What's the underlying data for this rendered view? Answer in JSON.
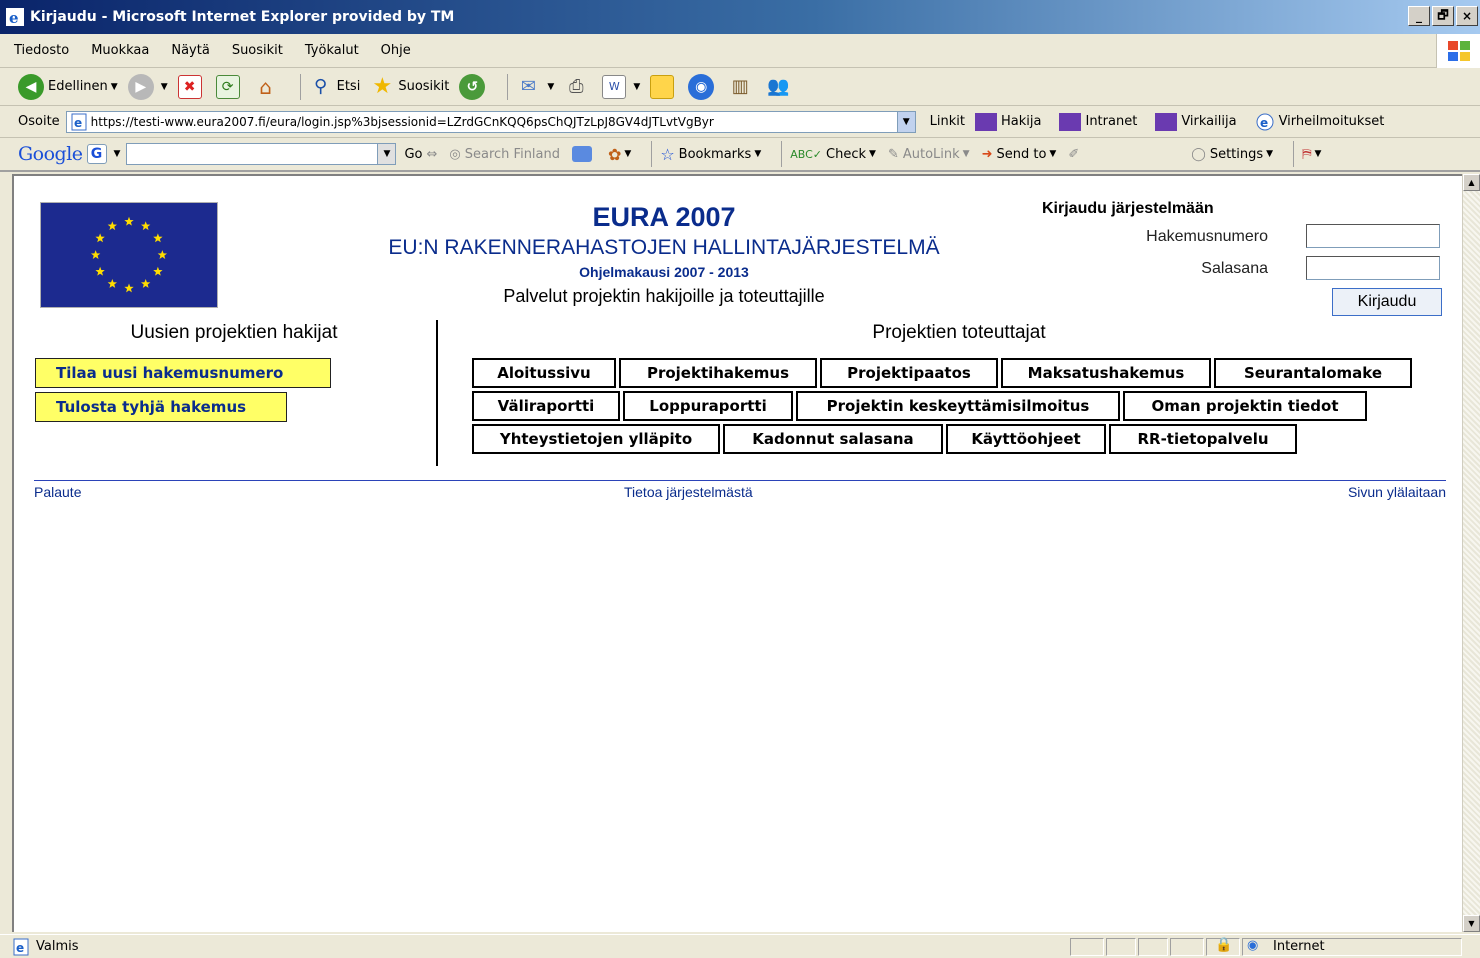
{
  "window": {
    "title": "Kirjaudu - Microsoft Internet Explorer provided by TM",
    "buttons": [
      "_",
      "🗗",
      "×"
    ]
  },
  "menubar": {
    "items": [
      "Tiedosto",
      "Muokkaa",
      "Näytä",
      "Suosikit",
      "Työkalut",
      "Ohje"
    ]
  },
  "toolbar": {
    "back_label": "Edellinen",
    "search_label": "Etsi",
    "favorites_label": "Suosikit"
  },
  "addressbar": {
    "label": "Osoite",
    "url": "https://testi-www.eura2007.fi/eura/login.jsp%3bjsessionid=LZrdGCnKQQ6psChQJTzLpJ8GV4dJTLvtVgByr",
    "links_label": "Linkit",
    "links": [
      "Hakija",
      "Intranet",
      "Virkailija",
      "Virheilmoitukset"
    ]
  },
  "googlebar": {
    "logo": "Google",
    "search_value": "",
    "go_label": "Go",
    "search_finland_label": "Search Finland",
    "bookmarks_label": "Bookmarks",
    "check_label": "Check",
    "autolink_label": "AutoLink",
    "sendto_label": "Send to",
    "settings_label": "Settings"
  },
  "header": {
    "title": "EURA 2007",
    "subtitle": "EU:N RAKENNERAHASTOJEN HALLINTAJÄRJESTELMÄ",
    "period": "Ohjelmakausi 2007 - 2013",
    "services": "Palvelut projektin hakijoille ja toteuttajille"
  },
  "login": {
    "title": "Kirjaudu järjestelmään",
    "application_label": "Hakemusnumero",
    "application_value": "",
    "password_label": "Salasana",
    "password_value": "",
    "submit_label": "Kirjaudu"
  },
  "applicants": {
    "heading": "Uusien projektien hakijat",
    "buttons": [
      "Tilaa uusi hakemusnumero",
      "Tulosta tyhjä hakemus"
    ]
  },
  "implementers": {
    "heading": "Projektien toteuttajat",
    "rows": [
      [
        "Aloitussivu",
        "Projektihakemus",
        "Projektipaatos",
        "Maksatushakemus",
        "Seurantalomake"
      ],
      [
        "Väliraportti",
        "Loppuraportti",
        "Projektin keskeyttämisilmoitus",
        "Oman projektin tiedot"
      ],
      [
        "Yhteystietojen ylläpito",
        "Kadonnut salasana",
        "Käyttöohjeet",
        "RR-tietopalvelu"
      ]
    ]
  },
  "footer": {
    "feedback": "Palaute",
    "about": "Tietoa järjestelmästä",
    "top": "Sivun ylälaitaan"
  },
  "statusbar": {
    "status": "Valmis",
    "zone": "Internet"
  }
}
